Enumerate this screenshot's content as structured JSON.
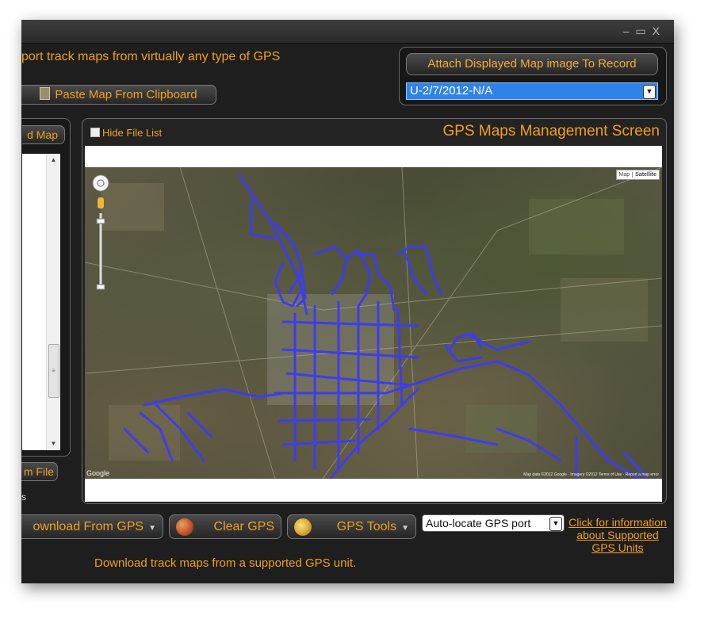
{
  "window": {
    "controls": [
      "–",
      "▭",
      "X"
    ]
  },
  "header": {
    "intro_text": "port track maps from virtually any type of GPS",
    "paste_button": "Paste Map From Clipboard",
    "attach_button": "Attach Displayed Map image To Record",
    "record_select": "U-2/7/2012-N/A"
  },
  "left_panel": {
    "add_map_button": "d Map",
    "from_file_button": "m File",
    "footer_text": "s"
  },
  "map_panel": {
    "hide_file_list": "Hide File List",
    "title": "GPS Maps Management Screen",
    "map_type": [
      "Map",
      "Satellite"
    ],
    "google_logo": "Google",
    "attribution": "Map data ©2012 Google · Imagery ©2012 Terms of Use · Report a map error"
  },
  "toolbar": {
    "download_button": "ownload From GPS",
    "clear_button": "Clear GPS",
    "tools_button": "GPS Tools",
    "port_select": "Auto-locate GPS port",
    "info_link": "Click for information about Supported GPS Units",
    "status": "Download track maps from a supported GPS unit."
  },
  "colors": {
    "accent": "#f0a020",
    "window_bg": "#1e1e1e",
    "selection": "#2e83e8",
    "track": "#3d3cf0"
  }
}
